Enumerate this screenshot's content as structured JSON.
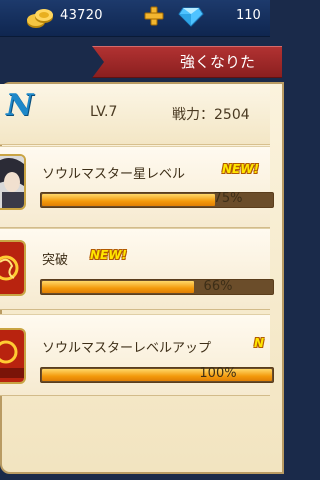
{
  "hud": {
    "coins": "43720",
    "gems": "110"
  },
  "ribbon": {
    "text": "強くなりた"
  },
  "header": {
    "brand_letter": "N",
    "level": "LV.7",
    "power": "戦力：2504"
  },
  "rows": [
    {
      "title": "ソウルマスター星レベル",
      "badge": "NEW!",
      "progress": 0.75,
      "percent_label": "75%"
    },
    {
      "title": "突破",
      "badge": "NEW!",
      "progress": 0.66,
      "percent_label": "66%"
    },
    {
      "title": "ソウルマスターレベルアップ",
      "badge": "N",
      "progress": 1.0,
      "percent_label": "100%"
    }
  ],
  "colors": {
    "ribbon": "#a02a2a",
    "bar_fill": "#f39a0c",
    "new_badge": "#ffe600",
    "brand": "#1e88c9"
  }
}
